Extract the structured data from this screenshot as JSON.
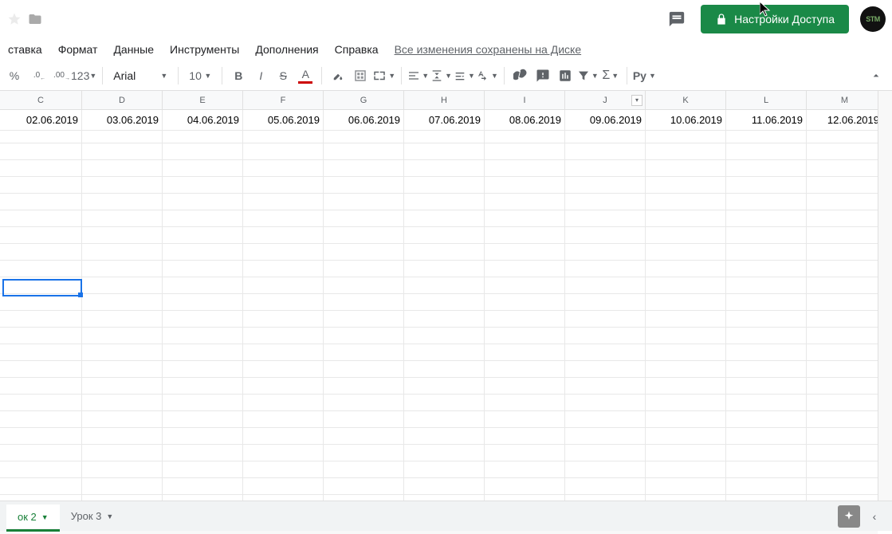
{
  "header": {
    "share_label": "Настройки Доступа",
    "avatar_text": "STM"
  },
  "menu": {
    "items": [
      "ставка",
      "Формат",
      "Данные",
      "Инструменты",
      "Дополнения",
      "Справка"
    ],
    "save_status": "Все изменения сохранены на Диске"
  },
  "toolbar": {
    "percent": "%",
    "dec_dec": ".0",
    "dec_inc": ".00",
    "num_fmt": "123",
    "font_name": "Arial",
    "font_size": "10",
    "script_label": "Рy"
  },
  "columns": [
    "C",
    "D",
    "E",
    "F",
    "G",
    "H",
    "I",
    "J",
    "K",
    "L",
    "M"
  ],
  "row1": [
    "02.06.2019",
    "03.06.2019",
    "04.06.2019",
    "05.06.2019",
    "06.06.2019",
    "07.06.2019",
    "08.06.2019",
    "09.06.2019",
    "10.06.2019",
    "11.06.2019",
    "12.06.2019"
  ],
  "sheets": {
    "active": "ок 2",
    "other": "Урок 3"
  }
}
